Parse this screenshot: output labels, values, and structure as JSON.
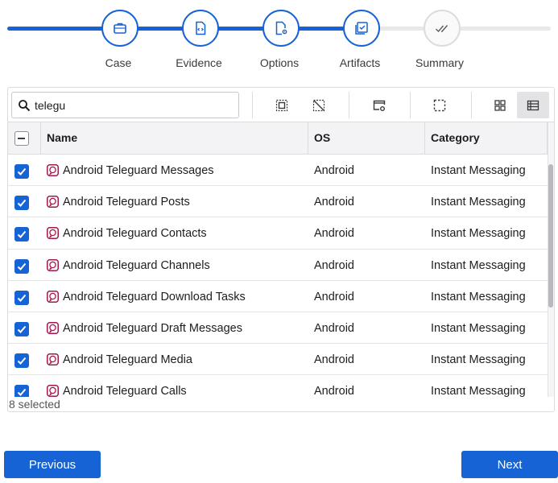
{
  "stepper": {
    "steps": [
      {
        "label": "Case",
        "icon": "briefcase-icon",
        "state": "done"
      },
      {
        "label": "Evidence",
        "icon": "file-code-icon",
        "state": "done"
      },
      {
        "label": "Options",
        "icon": "file-gear-icon",
        "state": "done"
      },
      {
        "label": "Artifacts",
        "icon": "checklist-icon",
        "state": "current"
      },
      {
        "label": "Summary",
        "icon": "double-check-icon",
        "state": "todo"
      }
    ]
  },
  "search": {
    "value": "telegu",
    "icon": "search-icon"
  },
  "toolbar": {
    "icons": [
      "select-all-icon",
      "deselect-icon",
      "window-settings-icon",
      "selection-box-icon",
      "grid-view-icon",
      "list-view-icon"
    ],
    "active_view": "list-view-icon"
  },
  "table": {
    "columns": [
      "Name",
      "OS",
      "Category"
    ],
    "rows": [
      {
        "name": "Android Teleguard Messages",
        "os": "Android",
        "category": "Instant Messaging",
        "checked": true
      },
      {
        "name": "Android Teleguard Posts",
        "os": "Android",
        "category": "Instant Messaging",
        "checked": true
      },
      {
        "name": "Android Teleguard Contacts",
        "os": "Android",
        "category": "Instant Messaging",
        "checked": true
      },
      {
        "name": "Android Teleguard Channels",
        "os": "Android",
        "category": "Instant Messaging",
        "checked": true
      },
      {
        "name": "Android Teleguard Download Tasks",
        "os": "Android",
        "category": "Instant Messaging",
        "checked": true
      },
      {
        "name": "Android Teleguard Draft Messages",
        "os": "Android",
        "category": "Instant Messaging",
        "checked": true
      },
      {
        "name": "Android Teleguard Media",
        "os": "Android",
        "category": "Instant Messaging",
        "checked": true
      },
      {
        "name": "Android Teleguard Calls",
        "os": "Android",
        "category": "Instant Messaging",
        "checked": true
      }
    ]
  },
  "status": {
    "selected_text": "8 selected"
  },
  "footer": {
    "previous_label": "Previous",
    "next_label": "Next"
  },
  "colors": {
    "accent": "#1663d6",
    "app_icon": "#a3174d"
  }
}
